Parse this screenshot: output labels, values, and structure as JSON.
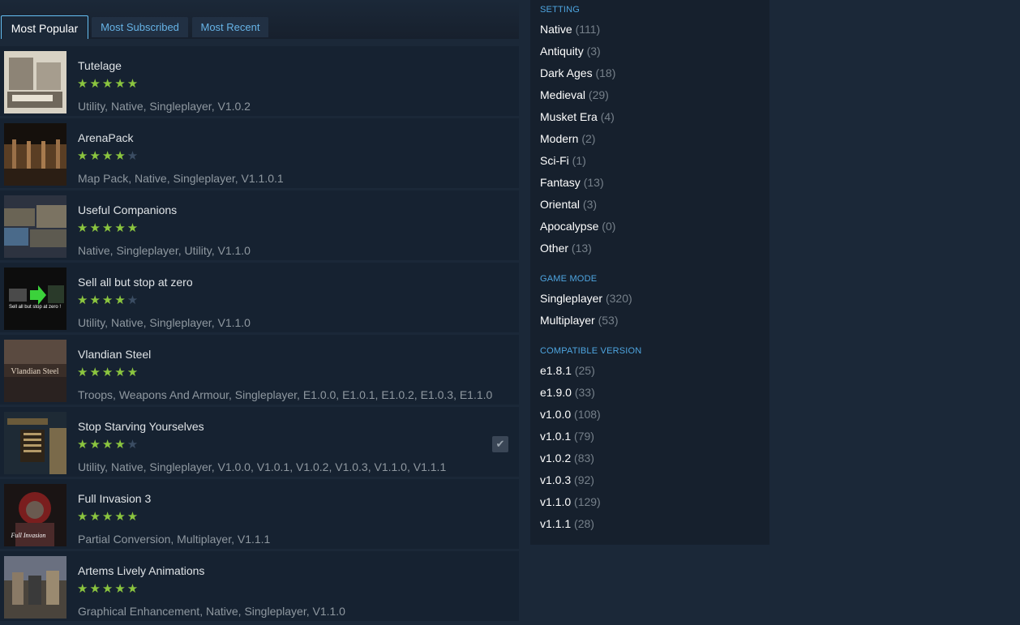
{
  "tabs": [
    {
      "label": "Most Popular"
    },
    {
      "label": "Most Subscribed"
    },
    {
      "label": "Most Recent"
    }
  ],
  "items": [
    {
      "title": "Tutelage",
      "rating": 5,
      "tags": "Utility, Native, Singleplayer, V1.0.2"
    },
    {
      "title": "ArenaPack",
      "rating": 4,
      "tags": "Map Pack, Native, Singleplayer, V1.1.0.1"
    },
    {
      "title": "Useful Companions",
      "rating": 5,
      "tags": "Native, Singleplayer, Utility, V1.1.0"
    },
    {
      "title": "Sell all but stop at zero",
      "rating": 4,
      "tags": "Utility, Native, Singleplayer, V1.1.0",
      "thumb_text": "Sell all but stop at zero !"
    },
    {
      "title": "Vlandian Steel",
      "rating": 5,
      "tags": "Troops, Weapons And Armour, Singleplayer, E1.0.0, E1.0.1, E1.0.2, E1.0.3, E1.1.0",
      "thumb_text": "Vlandian Steel"
    },
    {
      "title": "Stop Starving Yourselves",
      "rating": 4,
      "tags": "Utility, Native, Singleplayer, V1.0.0, V1.0.1, V1.0.2, V1.0.3, V1.1.0, V1.1.1",
      "subscribed": true
    },
    {
      "title": "Full Invasion 3",
      "rating": 5,
      "tags": "Partial Conversion, Multiplayer, V1.1.1",
      "thumb_text": "Full Invasion"
    },
    {
      "title": "Artems Lively Animations",
      "rating": 5,
      "tags": "Graphical Enhancement, Native, Singleplayer, V1.1.0"
    }
  ],
  "sidebar": {
    "setting": {
      "title": "SETTING",
      "items": [
        {
          "label": "Native",
          "count": "(111)"
        },
        {
          "label": "Antiquity",
          "count": "(3)"
        },
        {
          "label": "Dark Ages",
          "count": "(18)"
        },
        {
          "label": "Medieval",
          "count": "(29)"
        },
        {
          "label": "Musket Era",
          "count": "(4)"
        },
        {
          "label": "Modern",
          "count": "(2)"
        },
        {
          "label": "Sci-Fi",
          "count": "(1)"
        },
        {
          "label": "Fantasy",
          "count": "(13)"
        },
        {
          "label": "Oriental",
          "count": "(3)"
        },
        {
          "label": "Apocalypse",
          "count": "(0)"
        },
        {
          "label": "Other",
          "count": "(13)"
        }
      ]
    },
    "game_mode": {
      "title": "GAME MODE",
      "items": [
        {
          "label": "Singleplayer",
          "count": "(320)"
        },
        {
          "label": "Multiplayer",
          "count": "(53)"
        }
      ]
    },
    "compatible_version": {
      "title": "COMPATIBLE VERSION",
      "items": [
        {
          "label": "e1.8.1",
          "count": "(25)"
        },
        {
          "label": "e1.9.0",
          "count": "(33)"
        },
        {
          "label": "v1.0.0",
          "count": "(108)"
        },
        {
          "label": "v1.0.1",
          "count": "(79)"
        },
        {
          "label": "v1.0.2",
          "count": "(83)"
        },
        {
          "label": "v1.0.3",
          "count": "(92)"
        },
        {
          "label": "v1.1.0",
          "count": "(129)"
        },
        {
          "label": "v1.1.1",
          "count": "(28)"
        }
      ]
    }
  },
  "colors": {
    "background": "#1b2838",
    "accent": "#66c0f4",
    "star_on": "#8bc53f",
    "star_off": "#3b4d63"
  }
}
